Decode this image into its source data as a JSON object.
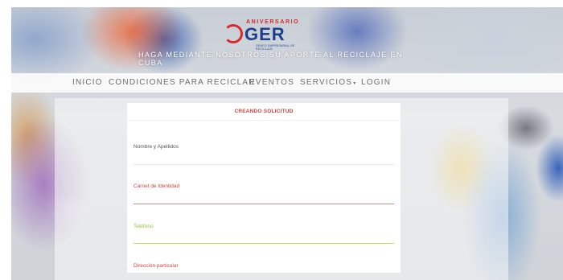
{
  "header": {
    "logo": {
      "number": "60",
      "aniversario": "ANIVERSARIO",
      "brand": "GER",
      "subtitle": "GRUPO EMPRESARIAL DE RECICLAJE"
    },
    "tagline": "HAGA MEDIANTE NOSOTROS SU APORTE AL RECICLAJE EN CUBA"
  },
  "nav": {
    "items": [
      {
        "label": "INICIO"
      },
      {
        "label": "CONDICIONES PARA RECICLAR"
      },
      {
        "label": "EVENTOS"
      },
      {
        "label": "SERVICIOS"
      },
      {
        "label": "LOGIN"
      }
    ],
    "dropdown_marker": "▾"
  },
  "form": {
    "title": "CREANDO SOLICITUD",
    "fields": [
      {
        "label": "Nombre y Apellidos",
        "value": "",
        "label_color": "#555555",
        "line_color": "#e6e6e6"
      },
      {
        "label": "Carnet de Identidad",
        "value": "",
        "label_color": "#d8413d",
        "line_color": "#e38a86"
      },
      {
        "label": "Teléfono",
        "value": "",
        "label_color": "#9abf3c",
        "line_color": "#b9d76a"
      },
      {
        "label": "Dirección particular",
        "value": "",
        "label_color": "#d8413d",
        "line_color": "#e38a86"
      }
    ]
  },
  "colors": {
    "brand_blue": "#1e3f8c",
    "brand_red": "#d52b2b",
    "nav_text": "#6d6d6d",
    "title_red": "#d8413d"
  }
}
